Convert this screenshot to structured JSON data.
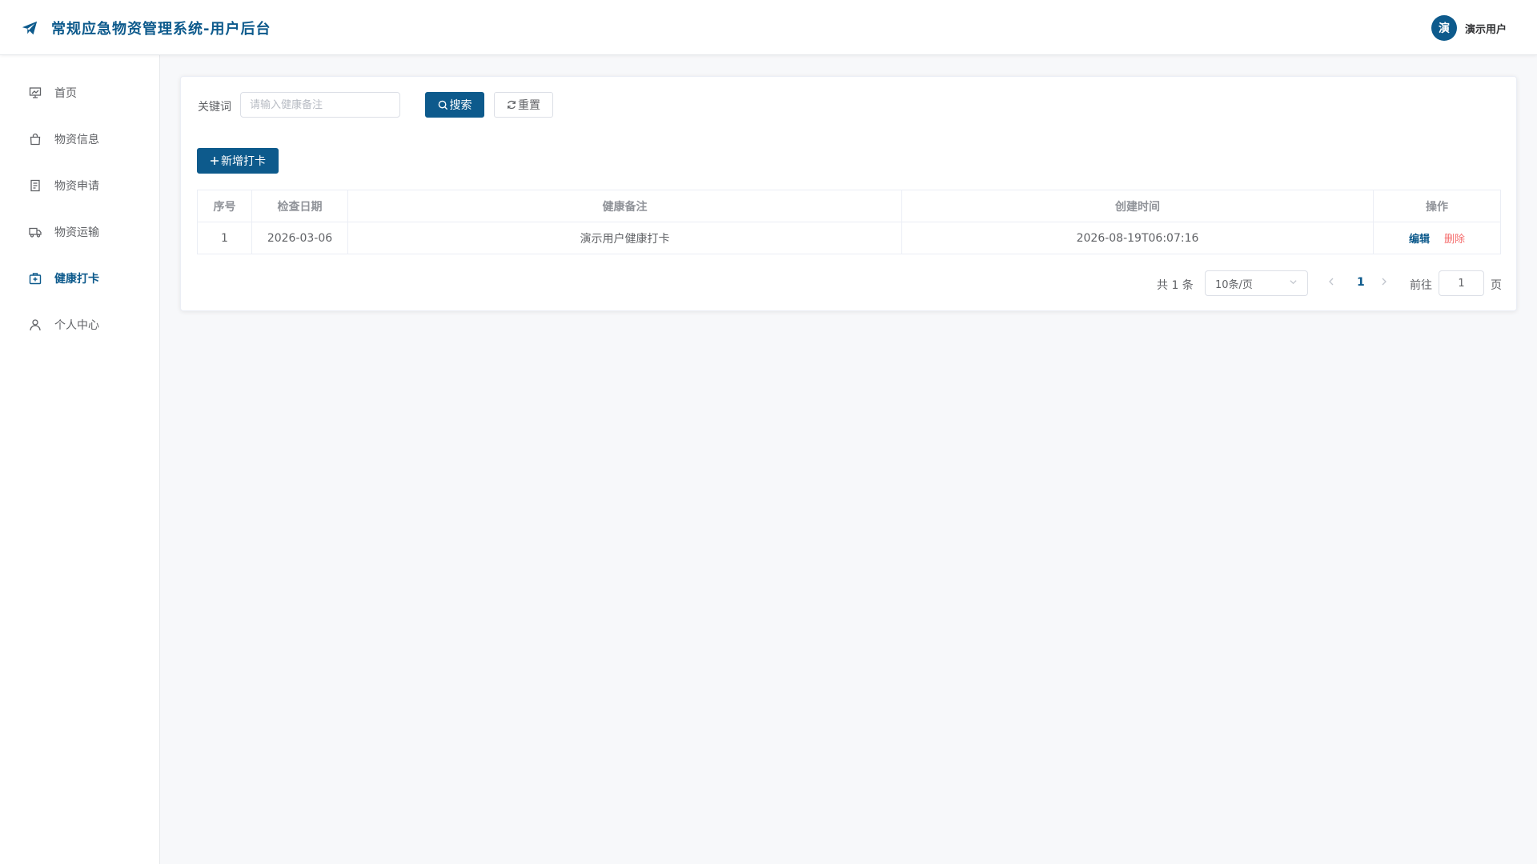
{
  "header": {
    "title": "常规应急物资管理系统-用户后台",
    "avatar_text": "演",
    "user_name": "演示用户",
    "logo_icon": "paper-plane-icon"
  },
  "sidebar": {
    "items": [
      {
        "label": "首页",
        "icon": "presentation-icon",
        "active": false
      },
      {
        "label": "物资信息",
        "icon": "shopping-bag-icon",
        "active": false
      },
      {
        "label": "物资申请",
        "icon": "document-icon",
        "active": false
      },
      {
        "label": "物资运输",
        "icon": "truck-icon",
        "active": false
      },
      {
        "label": "健康打卡",
        "icon": "first-aid-icon",
        "active": true
      },
      {
        "label": "个人中心",
        "icon": "user-icon",
        "active": false
      }
    ]
  },
  "search": {
    "label": "关键词",
    "placeholder": "请输入健康备注",
    "value": "",
    "search_button": "搜索",
    "reset_button": "重置"
  },
  "toolbar": {
    "add_button": "新增打卡"
  },
  "table": {
    "columns": [
      "序号",
      "检查日期",
      "健康备注",
      "创建时间",
      "操作"
    ],
    "rows": [
      {
        "index": "1",
        "date": "2026-03-06",
        "note": "演示用户健康打卡",
        "created": "2026-08-19T06:07:16",
        "edit": "编辑",
        "delete": "删除"
      }
    ]
  },
  "pagination": {
    "total_text": "共 1 条",
    "page_size": "10条/页",
    "current_page": "1",
    "goto_label": "前往",
    "goto_value": "1",
    "page_unit": "页"
  },
  "colors": {
    "primary": "#0d5a8c",
    "danger": "#f56c6c",
    "background": "#f7f8fa"
  }
}
